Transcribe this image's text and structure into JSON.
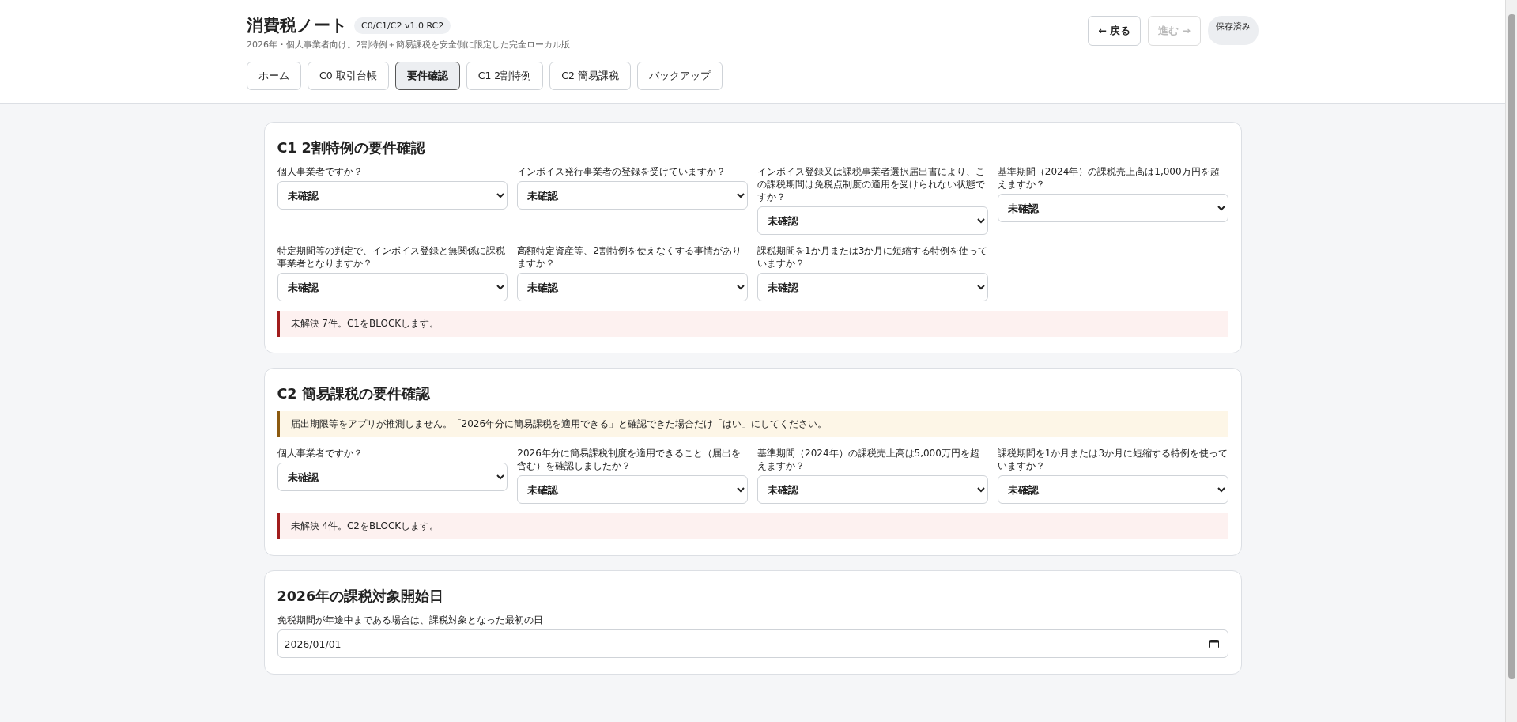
{
  "header": {
    "title": "消費税ノート",
    "version": "C0/C1/C2 v1.0 RC2",
    "subtitle": "2026年・個人事業者向け。2割特例＋簡易課税を安全側に限定した完全ローカル版",
    "back_button": {
      "label": "← 戻る",
      "disabled": false
    },
    "forward_button": {
      "label": "進む →",
      "disabled": true
    },
    "save_status": "保存済み"
  },
  "tabs": [
    {
      "label": "ホーム",
      "selected": false
    },
    {
      "label": "C0 取引台帳",
      "selected": false
    },
    {
      "label": "要件確認",
      "selected": true
    },
    {
      "label": "C1 2割特例",
      "selected": false
    },
    {
      "label": "C2 簡易課税",
      "selected": false
    },
    {
      "label": "バックアップ",
      "selected": false
    }
  ],
  "sections": [
    {
      "title": "C1 2割特例の要件確認",
      "questions": [
        {
          "label": "個人事業者ですか？",
          "value": "未確認"
        },
        {
          "label": "インボイス発行事業者の登録を受けていますか？",
          "value": "未確認"
        },
        {
          "label": "インボイス登録又は課税事業者選択届出書により、この課税期間は免税点制度の適用を受けられない状態ですか？",
          "value": "未確認"
        },
        {
          "label": "基準期間（2024年）の課税売上高は1,000万円を超えますか？",
          "value": "未確認"
        },
        {
          "label": "特定期間等の判定で、インボイス登録と無関係に課税事業者となりますか？",
          "value": "未確認"
        },
        {
          "label": "高額特定資産等、2割特例を使えなくする事情がありますか？",
          "value": "未確認"
        },
        {
          "label": "課税期間を1か月または3か月に短縮する特例を使っていますか？",
          "value": "未確認"
        }
      ],
      "alerts": [
        {
          "kind": "error",
          "text": "未解決 7件。C1をBLOCKします。"
        }
      ]
    },
    {
      "title": "C2 簡易課税の要件確認",
      "notices": [
        {
          "kind": "warning",
          "text": "届出期限等をアプリが推測しません。「2026年分に簡易課税を適用できる」と確認できた場合だけ「はい」にしてください。"
        }
      ],
      "questions": [
        {
          "label": "個人事業者ですか？",
          "value": "未確認"
        },
        {
          "label": "2026年分に簡易課税制度を適用できること（届出を含む）を確認しましたか？",
          "value": "未確認"
        },
        {
          "label": "基準期間（2024年）の課税売上高は5,000万円を超えますか？",
          "value": "未確認"
        },
        {
          "label": "課税期間を1か月または3か月に短縮する特例を使っていますか？",
          "value": "未確認"
        }
      ],
      "alerts": [
        {
          "kind": "error",
          "text": "未解決 4件。C2をBLOCKします。"
        }
      ]
    }
  ],
  "start_date": {
    "title": "2026年の課税対象開始日",
    "label": "免税期間が年途中まである場合は、課税対象となった最初の日",
    "value": "2026/01/01"
  }
}
